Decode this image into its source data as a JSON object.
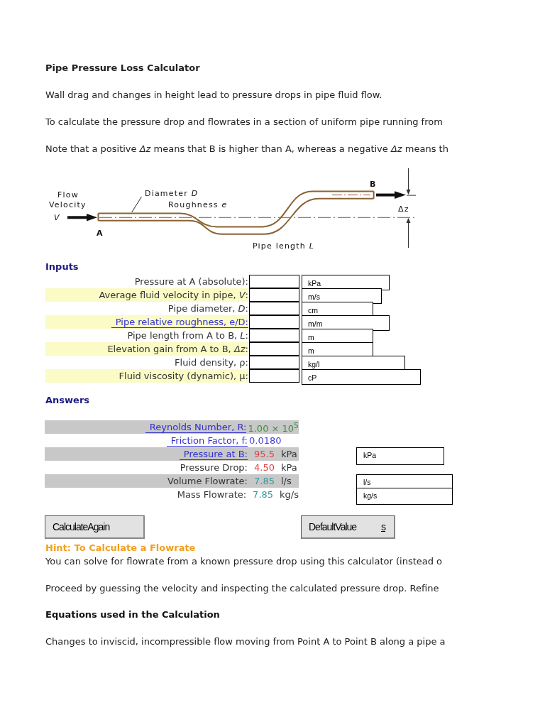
{
  "title": "Pipe Pressure Loss Calculator",
  "intro": [
    "Wall drag and changes in height lead to pressure drops in pipe fluid flow.",
    "To calculate the pressure drop and flowrates in a section of uniform pipe running from",
    "Note that a positive *Δz* means that B is higher than A, whereas a negative *Δz* means th"
  ],
  "diagram": {
    "flow_label": [
      "Flow",
      "Velocity"
    ],
    "velocity_symbol": "V",
    "point_a": "A",
    "point_b": "B",
    "diameter": {
      "text": "Diameter",
      "symbol": "D"
    },
    "roughness": {
      "text": "Roughness",
      "symbol": "e"
    },
    "elevation": "Δz",
    "length": {
      "text": "Pipe length",
      "symbol": "L"
    }
  },
  "inputs": {
    "heading": "Inputs",
    "rows": [
      {
        "label": "Pressure at A (absolute):",
        "link": false,
        "shaded": false,
        "unit": "kPa"
      },
      {
        "label": "Average fluid velocity in pipe, *V*:",
        "link": false,
        "shaded": true,
        "unit": "m/s"
      },
      {
        "label": "Pipe diameter, *D*:",
        "link": false,
        "shaded": false,
        "unit": "cm"
      },
      {
        "label": "Pipe relative roughness, e/D:",
        "link": true,
        "shaded": true,
        "unit": "m/m"
      },
      {
        "label": "Pipe length from A to B, *L*:",
        "link": false,
        "shaded": false,
        "unit": "m"
      },
      {
        "label": "Elevation gain from A to B, *Δz*:",
        "link": false,
        "shaded": true,
        "unit": "m"
      },
      {
        "label": "Fluid density, ρ:",
        "link": false,
        "shaded": false,
        "unit": "kg/l"
      },
      {
        "label": "Fluid viscosity (dynamic), μ:",
        "link": false,
        "shaded": true,
        "unit": "cP"
      }
    ]
  },
  "answers": {
    "heading": "Answers",
    "rows": [
      {
        "label": "Reynolds Number, R:",
        "link": true,
        "shaded": true,
        "value": "1.00 × 10$^{5}$",
        "color": "#3a8f3a"
      },
      {
        "label": "Friction Factor, f:",
        "link": true,
        "shaded": false,
        "value": "0.0180",
        "color": "#4040e0"
      },
      {
        "label": "Pressure at B:",
        "link": true,
        "shaded": true,
        "value": "95.5",
        "unit": "kPa",
        "color": "#e04040",
        "select": "kPa"
      },
      {
        "label": "Pressure Drop:",
        "link": false,
        "shaded": false,
        "value": "4.50",
        "unit": "kPa",
        "color": "#e04040"
      },
      {
        "label": "Volume Flowrate:",
        "link": false,
        "shaded": true,
        "value": "7.85",
        "unit": "l/s",
        "color": "#339999",
        "select": "l/s"
      },
      {
        "label": "Mass Flowrate:",
        "link": false,
        "shaded": false,
        "value": "7.85",
        "unit": "kg/s",
        "color": "#339999",
        "select": "kg/s"
      }
    ]
  },
  "buttons": [
    {
      "label": "CalculateAgain"
    },
    {
      "label": "DefaultValue",
      "mnemonic": "s"
    }
  ],
  "hint": {
    "heading": "Hint: To Calculate a Flowrate",
    "paragraphs": [
      "You can solve for flowrate from a known pressure drop using this calculator (instead o",
      "Proceed by guessing the velocity and inspecting the calculated pressure drop. Refine"
    ]
  },
  "equations": {
    "heading": "Equations used in the Calculation",
    "paragraphs": [
      "Changes to inviscid, incompressible flow moving from Point A to Point B along a pipe a"
    ]
  }
}
